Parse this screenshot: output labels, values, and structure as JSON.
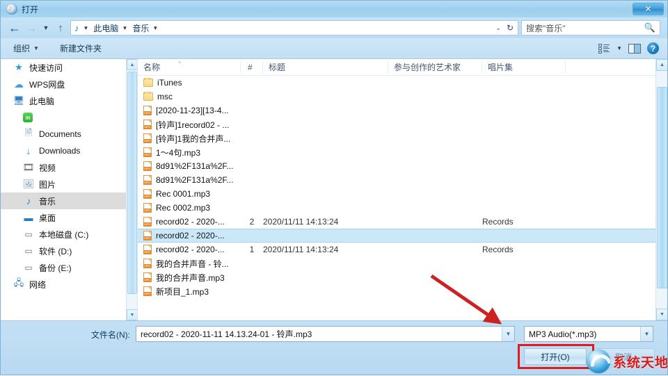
{
  "window": {
    "title": "打开",
    "title_icon": "music-app-icon",
    "close_label": "✕"
  },
  "nav": {
    "back_icon": "←",
    "forward_icon": "→",
    "history_caret": "▼",
    "up_icon": "↑",
    "crumb_icon": "♪",
    "crumbs": [
      "此电脑",
      "音乐"
    ],
    "crumb_caret": "▼",
    "dropdown_caret": "⌄",
    "refresh_icon": "↻"
  },
  "search": {
    "placeholder": "搜索\"音乐\"",
    "icon": "search-icon"
  },
  "toolbar": {
    "organize_label": "组织",
    "organize_caret": "▼",
    "new_folder_label": "新建文件夹",
    "view_caret": "▼",
    "help_label": "?"
  },
  "sidebar": {
    "items": [
      {
        "label": "快速访问",
        "icon": "star-icon",
        "indent": false,
        "selected": false
      },
      {
        "label": "WPS网盘",
        "icon": "cloud-icon",
        "indent": false,
        "selected": false
      },
      {
        "label": "此电脑",
        "icon": "computer-icon",
        "indent": false,
        "selected": false
      },
      {
        "label": "",
        "icon": "green-app-icon",
        "indent": true,
        "selected": false
      },
      {
        "label": "Documents",
        "icon": "documents-icon",
        "indent": true,
        "selected": false
      },
      {
        "label": "Downloads",
        "icon": "downloads-icon",
        "indent": true,
        "selected": false
      },
      {
        "label": "视频",
        "icon": "videos-icon",
        "indent": true,
        "selected": false
      },
      {
        "label": "图片",
        "icon": "pictures-icon",
        "indent": true,
        "selected": false
      },
      {
        "label": "音乐",
        "icon": "music-icon",
        "indent": true,
        "selected": true
      },
      {
        "label": "桌面",
        "icon": "desktop-icon",
        "indent": true,
        "selected": false
      },
      {
        "label": "本地磁盘 (C:)",
        "icon": "drive-icon",
        "indent": true,
        "selected": false
      },
      {
        "label": "软件 (D:)",
        "icon": "drive-icon",
        "indent": true,
        "selected": false
      },
      {
        "label": "备份 (E:)",
        "icon": "drive-icon",
        "indent": true,
        "selected": false
      },
      {
        "label": "网络",
        "icon": "network-icon",
        "indent": false,
        "selected": false
      }
    ]
  },
  "filelist": {
    "columns": [
      "名称",
      "#",
      "标题",
      "参与创作的艺术家",
      "唱片集"
    ],
    "sort_caret": "^",
    "rows": [
      {
        "name": "iTunes",
        "icon": "folder-icon",
        "num": "",
        "title": "",
        "artist": "",
        "album": "",
        "selected": false
      },
      {
        "name": "msc",
        "icon": "folder-icon",
        "num": "",
        "title": "",
        "artist": "",
        "album": "",
        "selected": false
      },
      {
        "name": "[2020-11-23][13-4...",
        "icon": "mp3-icon",
        "num": "",
        "title": "",
        "artist": "",
        "album": "",
        "selected": false
      },
      {
        "name": "[铃声]1record02 - ...",
        "icon": "mp3-icon",
        "num": "",
        "title": "",
        "artist": "",
        "album": "",
        "selected": false
      },
      {
        "name": "[铃声]1我的合并声...",
        "icon": "mp3-icon",
        "num": "",
        "title": "",
        "artist": "",
        "album": "",
        "selected": false
      },
      {
        "name": "1～4句.mp3",
        "icon": "mp3-icon",
        "num": "",
        "title": "",
        "artist": "",
        "album": "",
        "selected": false
      },
      {
        "name": "8d91%2F131a%2F...",
        "icon": "mp3-icon",
        "num": "",
        "title": "",
        "artist": "",
        "album": "",
        "selected": false
      },
      {
        "name": "8d91%2F131a%2F...",
        "icon": "mp3-icon",
        "num": "",
        "title": "",
        "artist": "",
        "album": "",
        "selected": false
      },
      {
        "name": "Rec 0001.mp3",
        "icon": "mp3-icon",
        "num": "",
        "title": "",
        "artist": "",
        "album": "",
        "selected": false
      },
      {
        "name": "Rec 0002.mp3",
        "icon": "mp3-icon",
        "num": "",
        "title": "",
        "artist": "",
        "album": "",
        "selected": false
      },
      {
        "name": "record02 - 2020-...",
        "icon": "mp3-icon",
        "num": "2",
        "title": "2020/11/11 14:13:24",
        "artist": "",
        "album": "Records",
        "selected": false
      },
      {
        "name": "record02 - 2020-...",
        "icon": "mp3-icon",
        "num": "",
        "title": "",
        "artist": "",
        "album": "",
        "selected": true
      },
      {
        "name": "record02 - 2020-...",
        "icon": "mp3-icon",
        "num": "1",
        "title": "2020/11/11 14:13:24",
        "artist": "",
        "album": "Records",
        "selected": false
      },
      {
        "name": "我的合并声音 - 铃...",
        "icon": "mp3-icon",
        "num": "",
        "title": "",
        "artist": "",
        "album": "",
        "selected": false
      },
      {
        "name": "我的合并声音.mp3",
        "icon": "mp3-icon",
        "num": "",
        "title": "",
        "artist": "",
        "album": "",
        "selected": false
      },
      {
        "name": "新项目_1.mp3",
        "icon": "mp3-icon",
        "num": "",
        "title": "",
        "artist": "",
        "album": "",
        "selected": false
      }
    ]
  },
  "footer": {
    "filename_label": "文件名(N):",
    "filename_value": "record02 - 2020-11-11 14.13.24-01 - 铃声.mp3",
    "filetype_value": "MP3 Audio(*.mp3)",
    "open_label": "打开(O)",
    "cancel_label": "取消",
    "dropdown_caret": "▼"
  },
  "watermark": {
    "text": "系统天地",
    "logo": "swirl-logo"
  },
  "annotations": {
    "arrow_color": "#cc2222",
    "box_color": "#e01b1b"
  }
}
